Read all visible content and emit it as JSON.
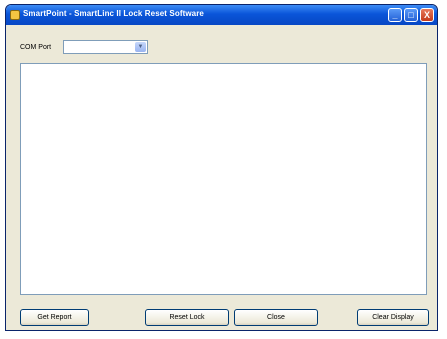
{
  "window": {
    "title": "SmartPoint - SmartLinc II Lock Reset Software",
    "controls": {
      "minimize": "_",
      "maximize": "□",
      "close": "X"
    }
  },
  "com_port": {
    "label": "COM Port",
    "value": "",
    "dropdown_glyph": "▼"
  },
  "display": {
    "text": ""
  },
  "buttons": {
    "get_report": "Get Report",
    "reset_lock": "Reset Lock",
    "close": "Close",
    "clear_display": "Clear Display"
  },
  "colors": {
    "titlebar": "#0a55d9",
    "window_bg": "#ece9d8",
    "close_button": "#c3391a"
  }
}
